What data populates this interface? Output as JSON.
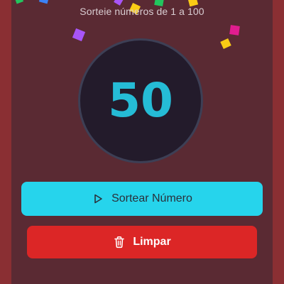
{
  "header": {
    "subtitle": "Sorteie números de 1 a 100"
  },
  "draw": {
    "current_number": "50"
  },
  "buttons": {
    "draw_label": "Sortear Número",
    "clear_label": "Limpar"
  },
  "history": {
    "title": ""
  },
  "colors": {
    "background": "#8a2f33",
    "card": "#5a2a33",
    "circle": "#231b2b",
    "number": "#25bcd6",
    "draw_button": "#26d4ec",
    "clear_button": "#dc2626",
    "confetti": [
      "#e11d8f",
      "#facc15",
      "#22c55e",
      "#a855f7",
      "#3b82f6"
    ]
  }
}
